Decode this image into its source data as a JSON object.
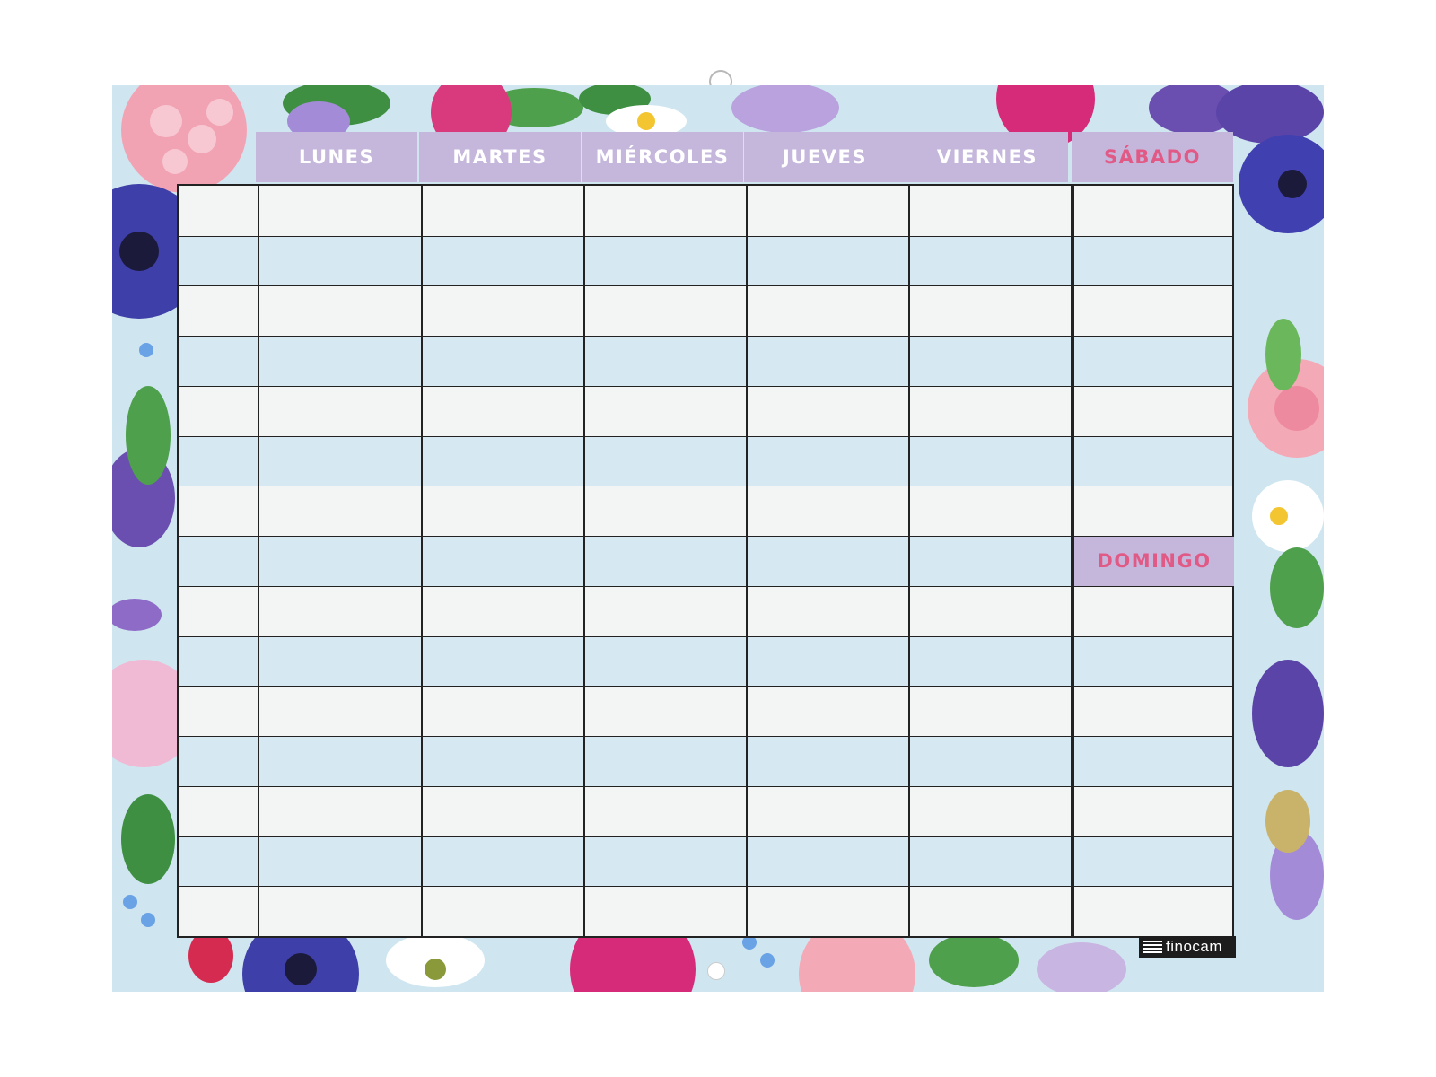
{
  "planner": {
    "days": [
      "LUNES",
      "MARTES",
      "MIÉRCOLES",
      "JUEVES",
      "VIERNES"
    ],
    "weekend": {
      "saturday": "SÁBADO",
      "sunday": "DOMINGO"
    },
    "rows": 15,
    "brand": "finocam"
  },
  "colors": {
    "header_bg": "#c5b6dc",
    "weekday_text": "#ffffff",
    "weekend_text": "#e15a86",
    "row_light": "#f3f5f4",
    "row_blue": "#d6e8f1",
    "border_bg": "#cfe6f0"
  },
  "decoration": {
    "flowers": [
      "hydrangea-pink",
      "anemone-blue",
      "peony-magenta",
      "rose-pink",
      "daisy-white",
      "iris-purple",
      "lilac",
      "forget-me-not"
    ]
  }
}
